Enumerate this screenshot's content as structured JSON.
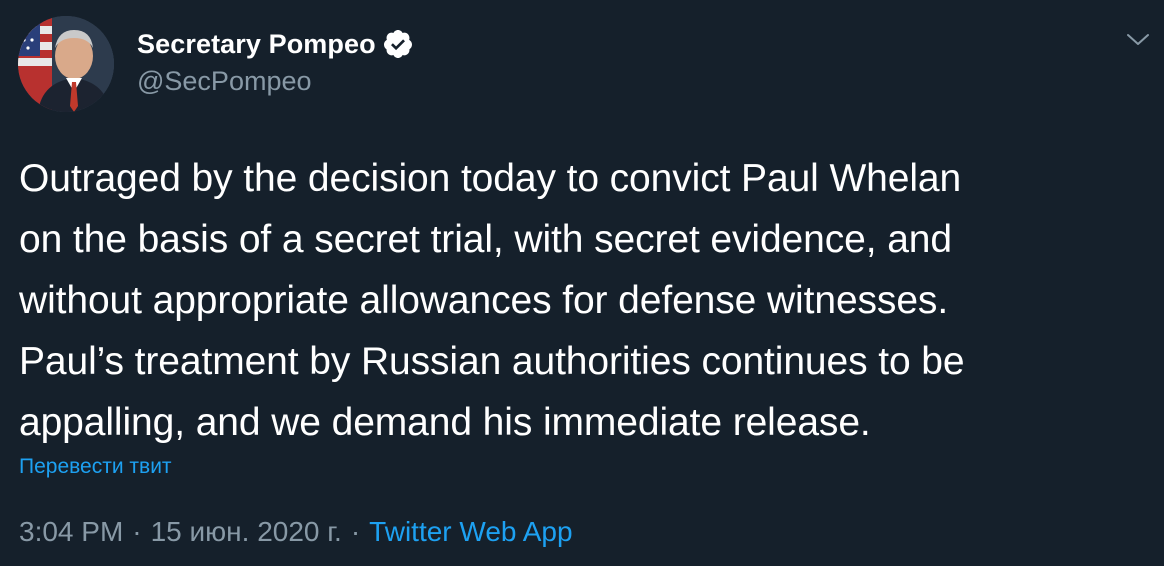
{
  "author": {
    "display_name": "Secretary Pompeo",
    "handle": "@SecPompeo",
    "verified_icon": "verified-badge-icon",
    "avatar_icon": "profile-avatar"
  },
  "menu": {
    "icon": "chevron-down-icon"
  },
  "tweet": {
    "text": "Outraged by the decision today to convict Paul Whelan\non the basis of a secret trial, with secret evidence, and\nwithout appropriate allowances for defense witnesses.\nPaul’s treatment by Russian authorities continues to be\nappalling, and we demand his immediate release.",
    "translate_label": "Перевести твит"
  },
  "meta": {
    "time": "3:04 PM",
    "separator": "·",
    "date": "15 июн. 2020 г.",
    "source": "Twitter Web App"
  },
  "colors": {
    "background": "#15202b",
    "text": "#ffffff",
    "secondary": "#8899a6",
    "accent": "#1da1f2"
  }
}
